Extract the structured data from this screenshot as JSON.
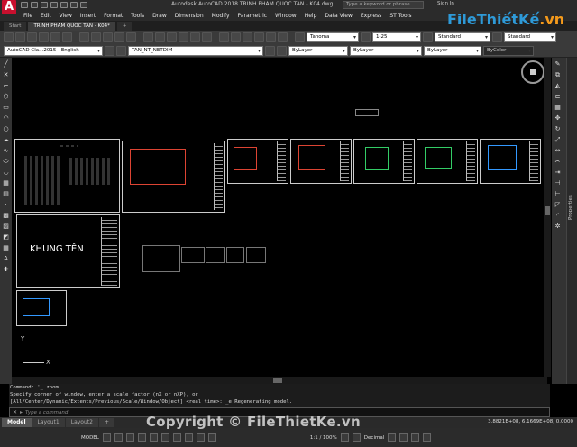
{
  "app": {
    "title": "Autodesk AutoCAD 2018    TRINH PHAM QUOC TAN - K04.dwg",
    "search_placeholder": "Type a keyword or phrase",
    "sign_in": "Sign In"
  },
  "menu": [
    "File",
    "Edit",
    "View",
    "Insert",
    "Format",
    "Tools",
    "Draw",
    "Dimension",
    "Modify",
    "Parametric",
    "Window",
    "Help",
    "Data View",
    "Express",
    "ST Tools"
  ],
  "tabs": [
    "Start",
    "TRINH PHAM QUOC TAN - K04*"
  ],
  "toolbar1": {
    "text_style": "Tahoma",
    "dim_scale": "1-25",
    "table_style": "Standard",
    "mleader_style": "Standard"
  },
  "toolbar2": {
    "workspace": "AutoCAD Cla...2015 - English",
    "layer": "TAN_NT_NETDIM",
    "color": "ByLayer",
    "linetype": "ByLayer",
    "lineweight": "ByLayer",
    "plotstyle": "ByColor"
  },
  "canvas": {
    "khung_ten": "KHUNG TÊN",
    "ucs_y": "Y",
    "ucs_x": "X"
  },
  "command": {
    "history": [
      "Command: '_.zoom",
      "Specify corner of window, enter a scale factor (nX or nXP), or",
      "[All/Center/Dynamic/Extents/Previous/Scale/Window/Object] <real time>: _e Regenerating model."
    ],
    "placeholder": "Type a command"
  },
  "layout_tabs": [
    "Model",
    "Layout1",
    "Layout2"
  ],
  "coords": "3.8821E+08, 6.1669E+08, 0.0000",
  "status": {
    "model": "MODEL",
    "scale": "1:1 / 100%",
    "units": "Decimal"
  },
  "right_panel": {
    "label": "Properties"
  },
  "watermark": {
    "logo": "FileThiếtKế",
    "logo_suffix": ".vn",
    "copyright": "Copyright © FileThietKe.vn"
  },
  "colors": {
    "accent_red": "#c8102e",
    "watermark_blue": "#2e9ad8",
    "watermark_orange": "#f59a1b"
  }
}
